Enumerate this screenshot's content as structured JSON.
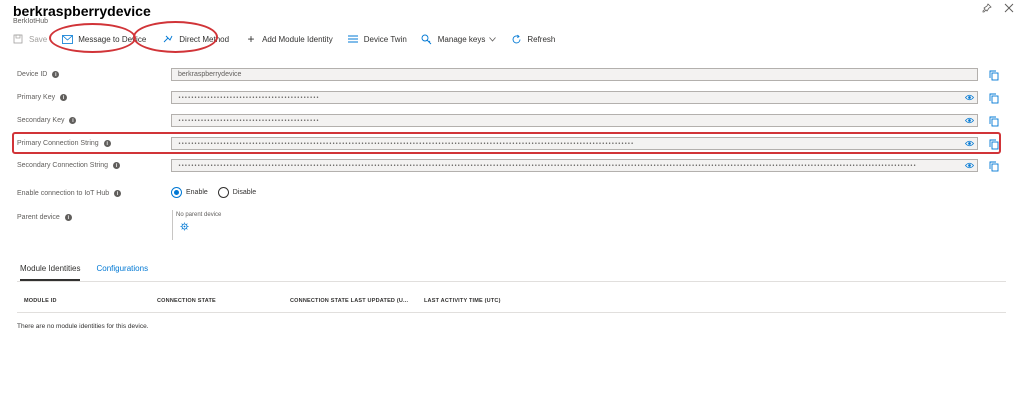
{
  "header": {
    "title": "berkraspberrydevice",
    "subtitle": "BerkIotHub"
  },
  "toolbar": {
    "save": "Save",
    "message_to_device": "Message to Device",
    "direct_method": "Direct Method",
    "add_module_identity": "Add Module Identity",
    "device_twin": "Device Twin",
    "manage_keys": "Manage keys",
    "refresh": "Refresh"
  },
  "fields": {
    "device_id": {
      "label": "Device ID",
      "value": "berkraspberrydevice"
    },
    "primary_key": {
      "label": "Primary Key",
      "value": "••••••••••••••••••••••••••••••••••••••••••••"
    },
    "secondary_key": {
      "label": "Secondary Key",
      "value": "••••••••••••••••••••••••••••••••••••••••••••"
    },
    "primary_conn": {
      "label": "Primary Connection String",
      "value": "••••••••••••••••••••••••••••••••••••••••••••••••••••••••••••••••••••••••••••••••••••••••••••••••••••••••••••••••••••••••••••••••••••••••••••••"
    },
    "secondary_conn": {
      "label": "Secondary Connection String",
      "value": "••••••••••••••••••••••••••••••••••••••••••••••••••••••••••••••••••••••••••••••••••••••••••••••••••••••••••••••••••••••••••••••••••••••••••••••••••••••••••••••••••••••••••••••••••••••••••••••••••••••••••••••••••••••••••••••••••••••"
    }
  },
  "enable_connection": {
    "label": "Enable connection to IoT Hub",
    "enable": "Enable",
    "disable": "Disable"
  },
  "parent_device": {
    "label": "Parent device",
    "value": "No parent device"
  },
  "tabs": {
    "module_identities": "Module Identities",
    "configurations": "Configurations"
  },
  "table": {
    "columns": [
      "MODULE ID",
      "CONNECTION STATE",
      "CONNECTION STATE LAST UPDATED (U...",
      "LAST ACTIVITY TIME (UTC)"
    ],
    "empty_message": "There are no module identities for this device."
  },
  "colors": {
    "accent": "#0078d4",
    "highlight": "#d13438"
  }
}
